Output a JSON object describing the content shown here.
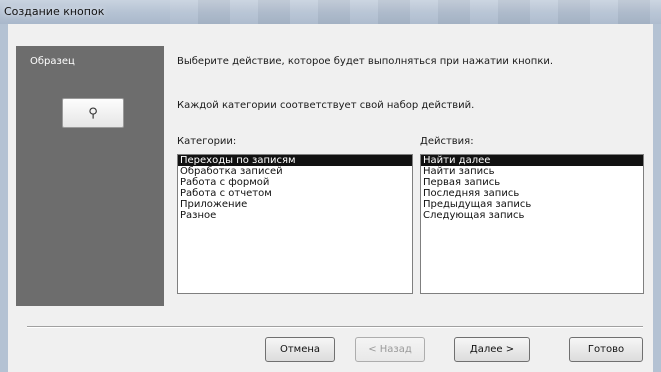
{
  "window": {
    "title": "Создание кнопок"
  },
  "sample": {
    "label": "Образец",
    "button_icon": "binoculars-icon",
    "button_glyph": "⚲"
  },
  "prompt": {
    "line1": "Выберите действие, которое будет выполняться при нажатии кнопки.",
    "line2": "Каждой категории соответствует свой набор действий."
  },
  "categories": {
    "label": "Категории:",
    "selected": "Переходы по записям",
    "items": [
      "Переходы по записям",
      "Обработка записей",
      "Работа с формой",
      "Работа с отчетом",
      "Приложение",
      "Разное"
    ]
  },
  "actions": {
    "label": "Действия:",
    "selected": "Найти далее",
    "items": [
      "Найти далее",
      "Найти запись",
      "Первая запись",
      "Последняя запись",
      "Предыдущая запись",
      "Следующая запись"
    ]
  },
  "buttons": {
    "cancel": "Отмена",
    "back": "< Назад",
    "next": "Далее >",
    "finish": "Готово"
  },
  "colors": {
    "sample_panel": "#6d6d6d",
    "selection": "#111111",
    "titlebar": "#b6c3d4"
  }
}
